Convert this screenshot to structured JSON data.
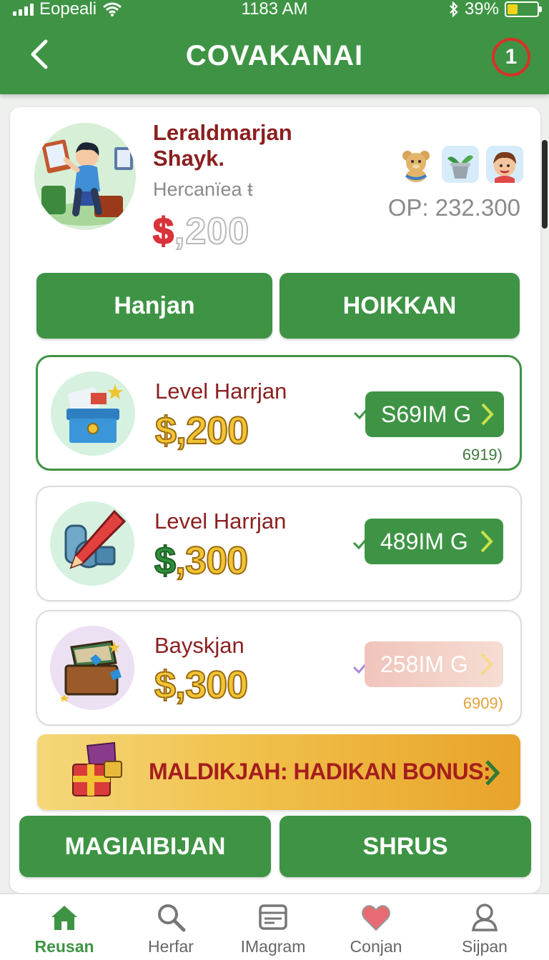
{
  "status_bar": {
    "carrier": "Eopeali",
    "time": "1183 AM",
    "battery": "39%"
  },
  "header": {
    "title": "COVAKANAI",
    "badge_count": "1"
  },
  "profile": {
    "name": "Leraldmarjan Shayk.",
    "subtitle": "Hercanïea ŧ",
    "balance_currency": "$",
    "balance_value": ",200",
    "op_value": "OP: 232.300",
    "mini_icons": [
      "teddy-bear-icon",
      "potted-plant-icon",
      "child-face-icon"
    ]
  },
  "actions": {
    "primary_left": "Hanjan",
    "primary_right": "HOIKKAN"
  },
  "cards": [
    {
      "title": "Level Harrjan",
      "currency": "$",
      "amount": ",200",
      "pill_label": "S69IM G",
      "code": "6919)",
      "icon": "gift-box-icon"
    },
    {
      "title": "Level Harrjan",
      "currency": "$",
      "amount": ",300",
      "pill_label": "489IM G",
      "code": "",
      "icon": "pencil-tool-icon"
    },
    {
      "title": "Bayskjan",
      "currency": "$",
      "amount": ",300",
      "pill_label": "258IM G",
      "code": "6909)",
      "icon": "treasure-chest-icon"
    }
  ],
  "bonus": {
    "label": "MALDIKJAH: HADIKAN BONUS:"
  },
  "bottom_actions": {
    "left": "MAGIAIBIJAN",
    "right": "SHRUS"
  },
  "nav": [
    {
      "label": "Reusan",
      "icon": "home-icon",
      "active": true
    },
    {
      "label": "Herfar",
      "icon": "search-icon",
      "active": false
    },
    {
      "label": "IMagram",
      "icon": "wallet-icon",
      "active": false
    },
    {
      "label": "Conjan",
      "icon": "heart-icon",
      "active": false
    },
    {
      "label": "Sijpan",
      "icon": "user-icon",
      "active": false
    }
  ],
  "colors": {
    "primary_green": "#3e9444",
    "title_red": "#8b1f1f",
    "accent_gold": "#f2c433"
  }
}
